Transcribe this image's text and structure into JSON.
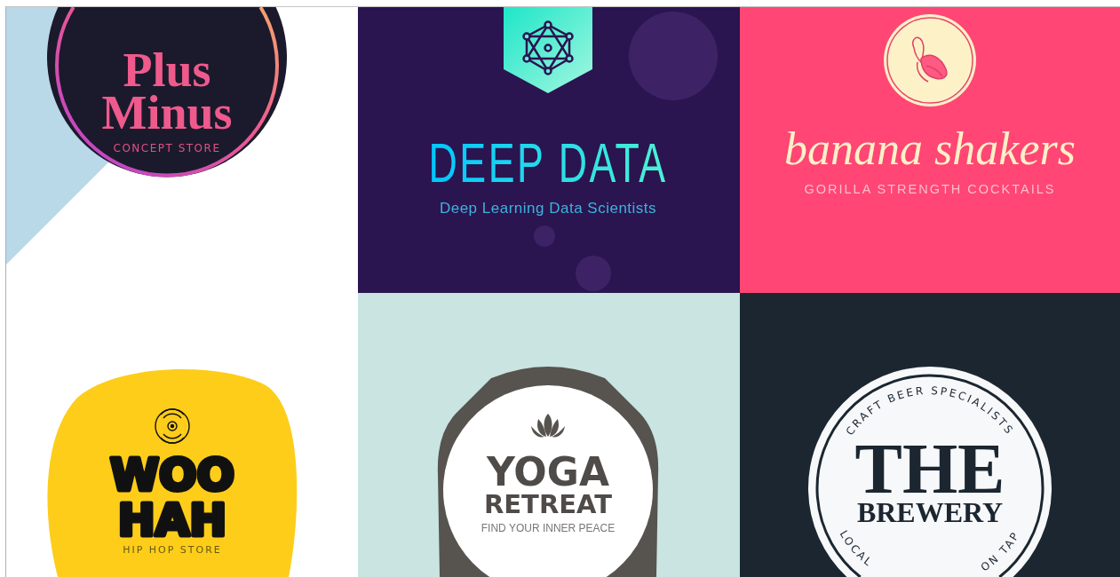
{
  "logos": [
    {
      "kind": "plus_minus",
      "title_lines": [
        "Plus",
        "Minus"
      ],
      "tagline": "CONCEPT STORE"
    },
    {
      "kind": "deep_data",
      "title_lines": [
        "DEEP DATA"
      ],
      "tagline": "Deep Learning Data Scientists"
    },
    {
      "kind": "banana_shakers",
      "title_lines": [
        "banana shakers"
      ],
      "tagline": "GORILLA STRENGTH COCKTAILS"
    },
    {
      "kind": "woo_hah",
      "title_lines": [
        "WOO",
        "HAH"
      ],
      "tagline": "HIP HOP STORE"
    },
    {
      "kind": "yoga_retreat",
      "title_lines": [
        "YOGA",
        "RETREAT"
      ],
      "tagline": "FIND YOUR INNER PEACE"
    },
    {
      "kind": "brewery",
      "title_lines": [
        "THE",
        "BREWERY"
      ],
      "ring_texts": [
        "CRAFT BEER SPECIALISTS",
        "LOCAL",
        "ON TAP"
      ]
    }
  ]
}
